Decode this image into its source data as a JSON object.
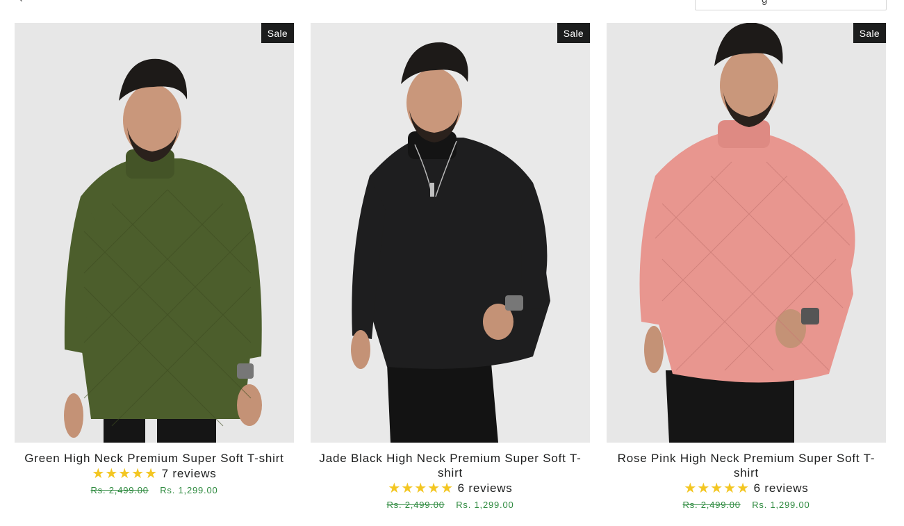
{
  "sort": {
    "label": "g"
  },
  "products": [
    {
      "title": "Green High Neck Premium Super Soft T-shirt",
      "badge": "Sale",
      "stars": "★★★★★",
      "rating_value": 5,
      "reviews": "7 reviews",
      "compare_price": "Rs. 2,499.00",
      "price": "Rs. 1,299.00",
      "shirt_color": "#4c5e2c"
    },
    {
      "title": "Jade Black High Neck Premium Super Soft T-shirt",
      "badge": "Sale",
      "stars": "★★★★★",
      "rating_value": 5,
      "reviews": "6 reviews",
      "compare_price": "Rs. 2,499.00",
      "price": "Rs. 1,299.00",
      "shirt_color": "#1e1e1f"
    },
    {
      "title": "Rose Pink High Neck Premium Super Soft T-shirt",
      "badge": "Sale",
      "stars": "★★★★★",
      "rating_value": 5,
      "reviews": "6 reviews",
      "compare_price": "Rs. 2,499.00",
      "price": "Rs. 1,299.00",
      "shirt_color": "#e8968f"
    }
  ],
  "colors": {
    "accent_price": "#2e8a3f",
    "star": "#f3c621",
    "badge_bg": "#1c1d1d"
  }
}
